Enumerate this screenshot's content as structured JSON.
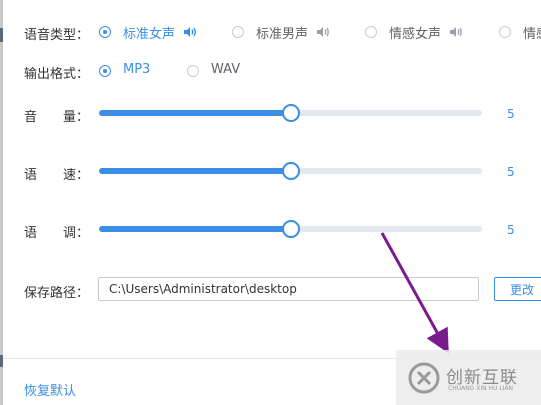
{
  "voice_type": {
    "label": "语音类型：",
    "options": [
      {
        "label": "标准女声",
        "checked": true
      },
      {
        "label": "标准男声",
        "checked": false
      },
      {
        "label": "情感女声",
        "checked": false
      },
      {
        "label": "情感",
        "checked": false
      }
    ]
  },
  "output_format": {
    "label": "输出格式：",
    "options": [
      {
        "label": "MP3",
        "checked": true
      },
      {
        "label": "WAV",
        "checked": false
      }
    ]
  },
  "sliders": [
    {
      "label": "音　　量：",
      "value": "5",
      "fraction": 0.5
    },
    {
      "label": "语　　速：",
      "value": "5",
      "fraction": 0.5
    },
    {
      "label": "语　　调：",
      "value": "5",
      "fraction": 0.5
    }
  ],
  "save_path": {
    "label": "保存路径：",
    "value": "C:\\Users\\Administrator\\desktop",
    "button_label": "更改"
  },
  "footer": {
    "reset_label": "恢复默认"
  },
  "watermark": {
    "title": "创新互联",
    "subtitle": "CHUANG XIN HU LIAN"
  },
  "colors": {
    "accent": "#3a8ee6",
    "annotation_arrow": "#7a1b8a"
  },
  "icons": {
    "speaker": "speaker-icon"
  }
}
